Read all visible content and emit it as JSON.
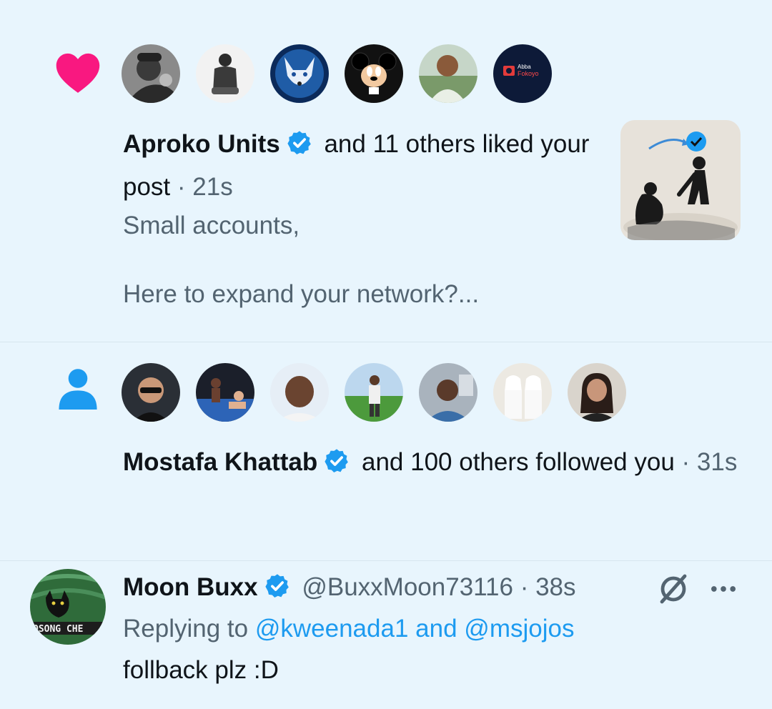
{
  "like_notification": {
    "icon": "heart-icon",
    "icon_color": "#f91880",
    "avatars": [
      "avatar-bearded-man",
      "avatar-seated-man",
      "avatar-glowing-wolf",
      "avatar-mickey-mouse",
      "avatar-man-outdoors",
      "avatar-abba-fokoyo-logo"
    ],
    "logo_text_line1": "Abba",
    "logo_text_line2": "Fokoyo",
    "actor_name": "Aproko Units",
    "action_text": "and 11 others liked your post",
    "separator": "·",
    "time": "21s",
    "post_preview": "Small accounts,\n\nHere to expand your network?...",
    "thumbnail": "helping-hand-verified-image"
  },
  "follow_notification": {
    "icon": "person-icon",
    "icon_color": "#1d9bf0",
    "avatars": [
      "avatar-sunglasses-man",
      "avatar-boxing-ring",
      "avatar-selfie-man",
      "avatar-man-field",
      "avatar-man-car",
      "avatar-two-men-uae",
      "avatar-woman"
    ],
    "actor_name": "Mostafa Khattab",
    "action_text": "and 100 others followed you",
    "separator": "·",
    "time": "31s"
  },
  "reply": {
    "avatar": "avatar-cat-banner",
    "avatar_text": "OSONG CHE",
    "name": "Moon Buxx",
    "handle": "@BuxxMoon73116",
    "separator": "·",
    "time": "38s",
    "replying_prefix": "Replying to",
    "mention_1": "@kweenada1",
    "mention_joiner": "and",
    "mention_2": "@msjojos",
    "body": "follback plz :D"
  },
  "colors": {
    "background": "#e8f5fd",
    "text_primary": "#0f1419",
    "text_secondary": "#536471",
    "accent": "#1d9bf0",
    "like": "#f91880"
  }
}
